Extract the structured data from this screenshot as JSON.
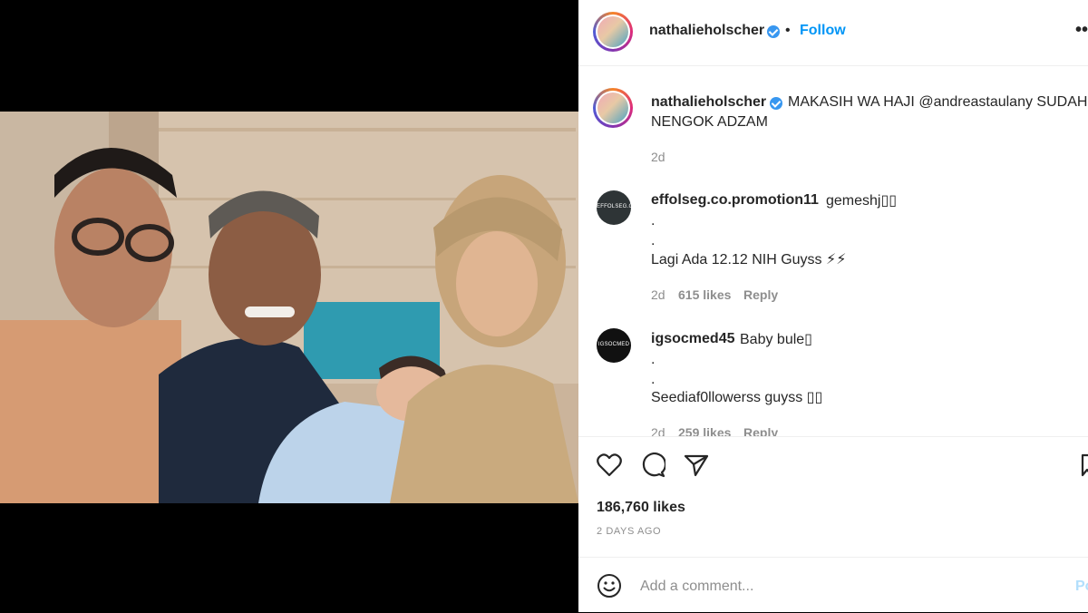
{
  "post": {
    "username": "nathalieholscher",
    "follow_label": "Follow",
    "dot": "•",
    "more": "•••"
  },
  "caption": {
    "username": "nathalieholscher",
    "line1": "MAKASIH WA HAJI @andreastaulany SUDAH",
    "line2": "NENGOK ADZAM",
    "time": "2d"
  },
  "comments": [
    {
      "username": "effolseg.co.promotion11",
      "avatar_text": "EFFOLSEG.CO",
      "lines": [
        "gemeshj▯▯",
        ".",
        ".",
        "Lagi Ada 12.12 NIH Guyss ⚡⚡"
      ],
      "time": "2d",
      "likes": "615 likes",
      "reply": "Reply"
    },
    {
      "username": "igsocmed45",
      "avatar_text": "IGSOCMED",
      "lines": [
        "Baby bule▯",
        ".",
        ".",
        "Seediaf0llowerss guyss ▯▯"
      ],
      "time": "2d",
      "likes": "259 likes",
      "reply": "Reply"
    }
  ],
  "actions": {
    "likes": "186,760 likes",
    "timestamp": "2 DAYS AGO"
  },
  "add_comment": {
    "placeholder": "Add a comment...",
    "post_label": "Po"
  },
  "icons": [
    "heart-icon",
    "comment-icon",
    "share-icon",
    "bookmark-icon",
    "emoji-icon",
    "verified-icon"
  ],
  "colors": {
    "follow": "#0095f6",
    "verified": "#3897f0",
    "muted": "#8e8e8e"
  }
}
